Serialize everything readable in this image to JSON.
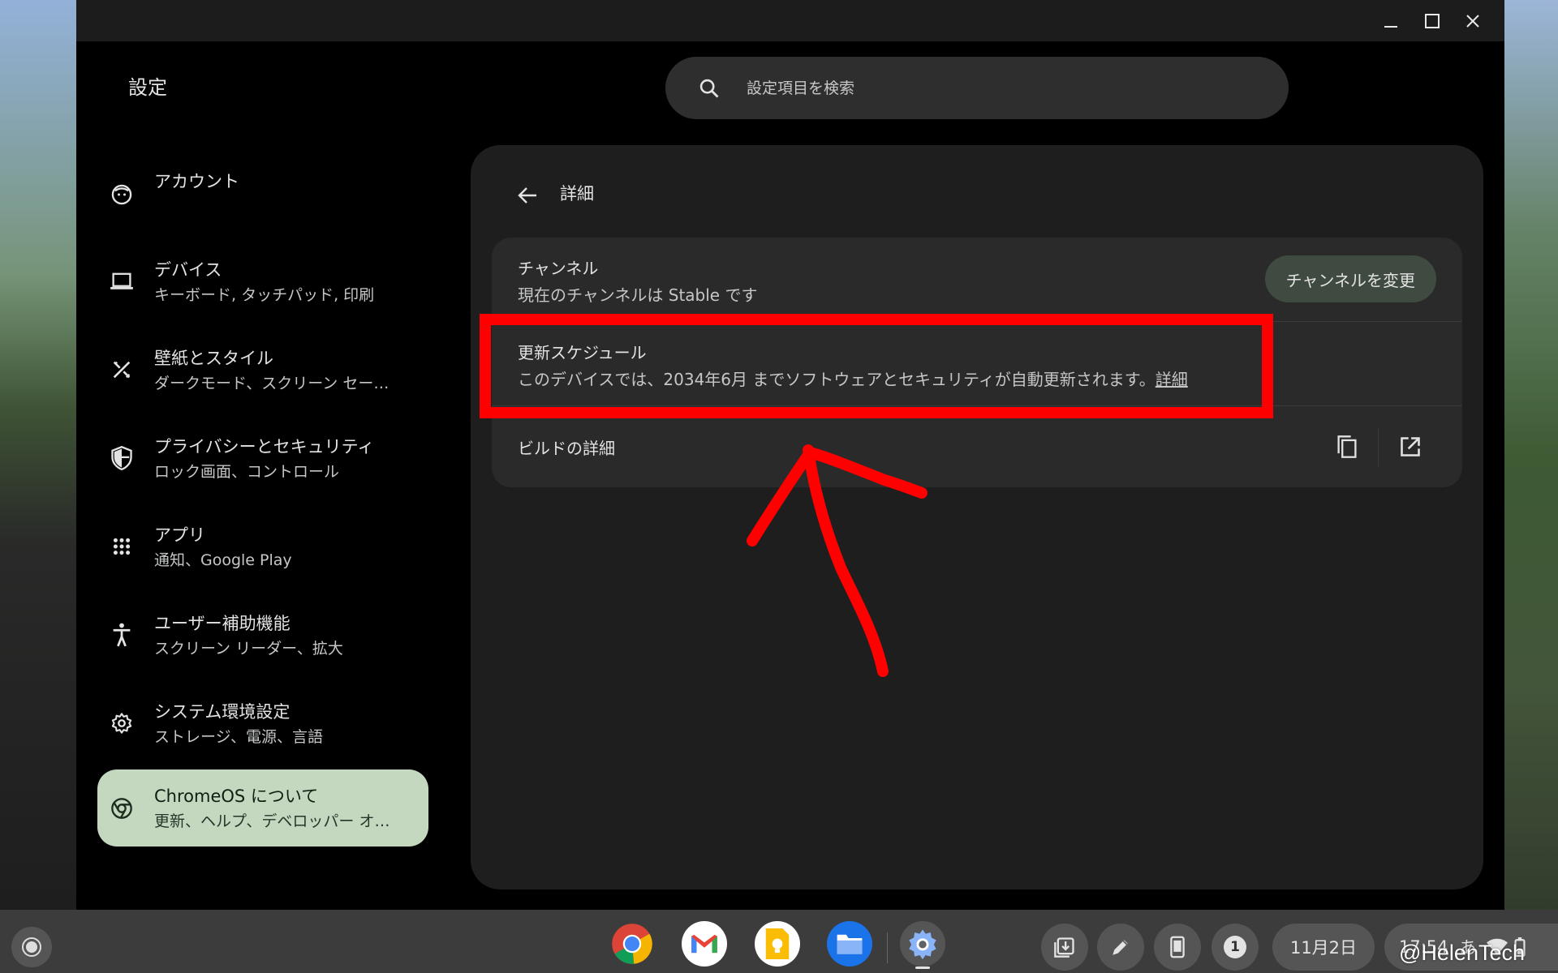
{
  "window": {
    "title": "設定",
    "controls": {
      "minimize": "—",
      "maximize": "☐",
      "close": "✕"
    }
  },
  "search": {
    "placeholder": "設定項目を検索"
  },
  "sidebar": {
    "items": [
      {
        "title": "アカウント",
        "subtitle": "",
        "icon": "account-icon"
      },
      {
        "title": "デバイス",
        "subtitle": "キーボード, タッチパッド, 印刷",
        "icon": "laptop-icon"
      },
      {
        "title": "壁紙とスタイル",
        "subtitle": "ダークモード、スクリーン セー…",
        "icon": "palette-icon"
      },
      {
        "title": "プライバシーとセキュリティ",
        "subtitle": "ロック画面、コントロール",
        "icon": "shield-icon"
      },
      {
        "title": "アプリ",
        "subtitle": "通知、Google Play",
        "icon": "apps-grid-icon"
      },
      {
        "title": "ユーザー補助機能",
        "subtitle": "スクリーン リーダー、拡大",
        "icon": "accessibility-icon"
      },
      {
        "title": "システム環境設定",
        "subtitle": "ストレージ、電源、言語",
        "icon": "gear-icon"
      },
      {
        "title": "ChromeOS について",
        "subtitle": "更新、ヘルプ、デベロッパー オ…",
        "icon": "chromeos-icon",
        "active": true
      }
    ]
  },
  "main": {
    "heading": "詳細",
    "channel": {
      "title": "チャンネル",
      "subtitle": "現在のチャンネルは Stable です",
      "button": "チャンネルを変更"
    },
    "schedule": {
      "title": "更新スケジュール",
      "subtitle": "このデバイスでは、2034年6月 までソフトウェアとセキュリティが自動更新されます。",
      "link": "詳細"
    },
    "build": {
      "title": "ビルドの詳細"
    }
  },
  "shelf": {
    "apps": [
      "chrome-icon",
      "gmail-icon",
      "keep-icon",
      "files-icon",
      "settings-icon"
    ],
    "notification_count": "1",
    "date": "11月2日",
    "time": "17:54",
    "ime": "あ"
  },
  "watermark": "@HelenTech",
  "colors": {
    "panel": "#1e1e1e",
    "card": "#2a2a2a",
    "active_nav": "#c4d8c0",
    "annotation": "#ff0000"
  }
}
